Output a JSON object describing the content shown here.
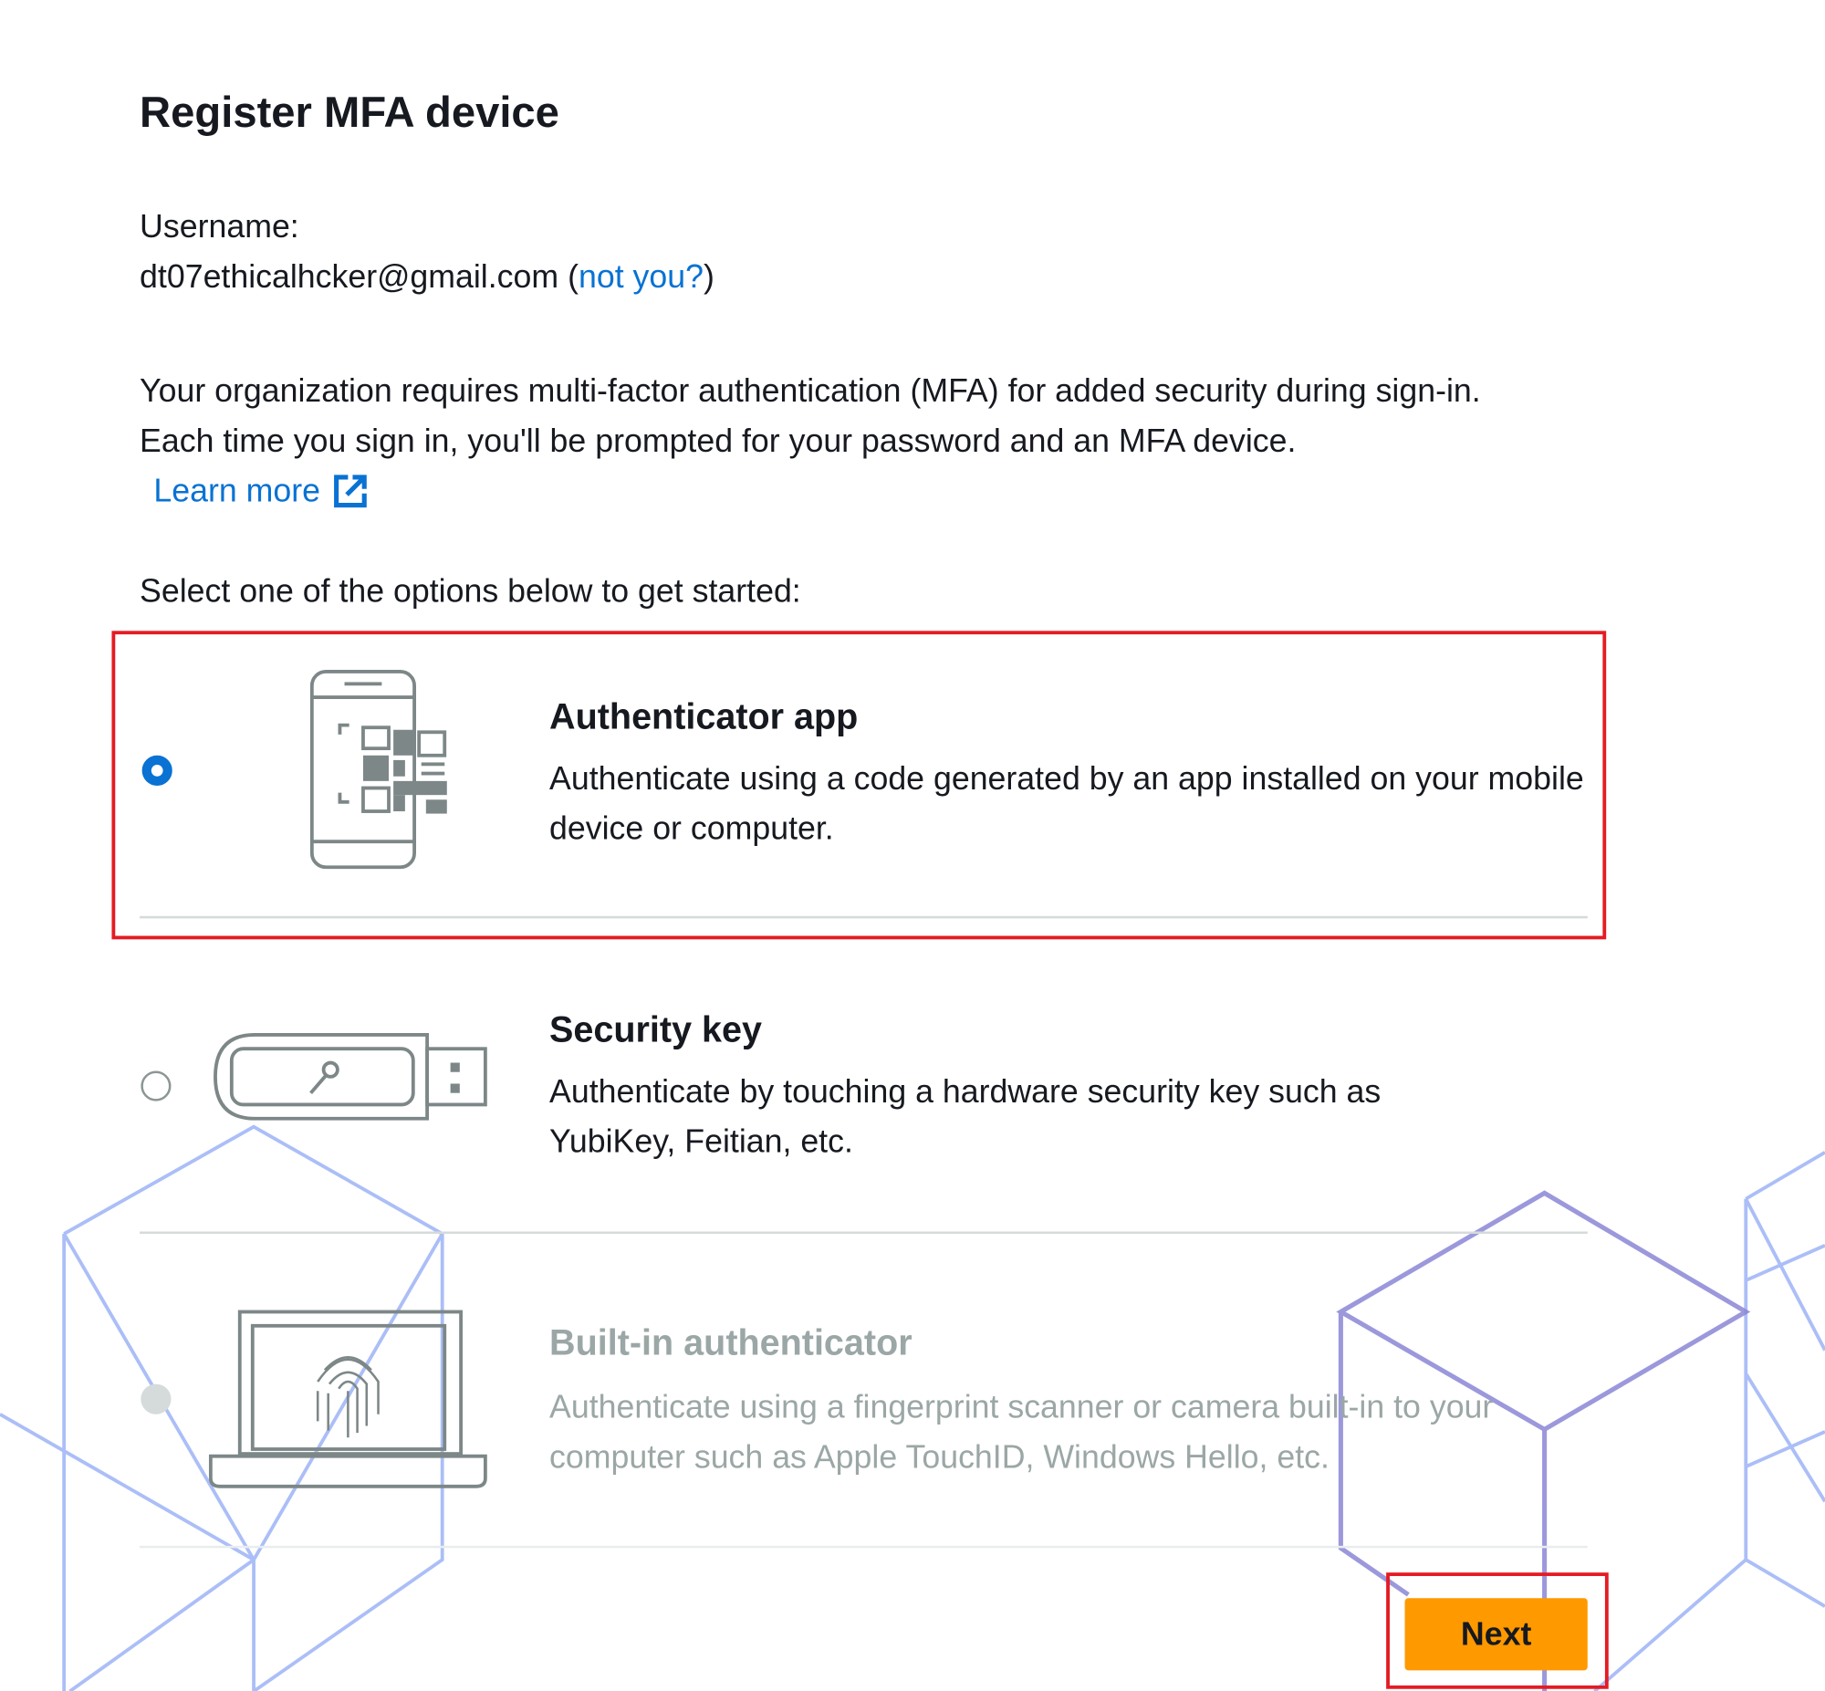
{
  "page": {
    "title": "Register MFA device",
    "username_label": "Username:",
    "username": "dt07ethicalhcker@gmail.com",
    "not_you_open": "(",
    "not_you_link": "not you?",
    "not_you_close": ")",
    "description": "Your organization requires multi-factor authentication (MFA) for added security during sign-in. Each time you sign in, you'll be prompted for your password and an MFA device.",
    "learn_more": "Learn more",
    "select_prompt": "Select one of the options below to get started:"
  },
  "options": [
    {
      "title": "Authenticator app",
      "description": "Authenticate using a code generated by an app installed on your mobile device or computer.",
      "selected": true,
      "disabled": false,
      "icon": "phone-qr-icon"
    },
    {
      "title": "Security key",
      "description": "Authenticate by touching a hardware security key such as YubiKey, Feitian, etc.",
      "selected": false,
      "disabled": false,
      "icon": "usb-key-icon"
    },
    {
      "title": "Built-in authenticator",
      "description": "Authenticate using a fingerprint scanner or camera built-in to your computer such as Apple TouchID, Windows Hello, etc.",
      "selected": false,
      "disabled": true,
      "icon": "laptop-fingerprint-icon"
    }
  ],
  "actions": {
    "next": "Next"
  },
  "colors": {
    "accent": "#0972d3",
    "button": "#ff9900",
    "highlight": "#e41b23",
    "disabled": "#9ba7a6"
  }
}
